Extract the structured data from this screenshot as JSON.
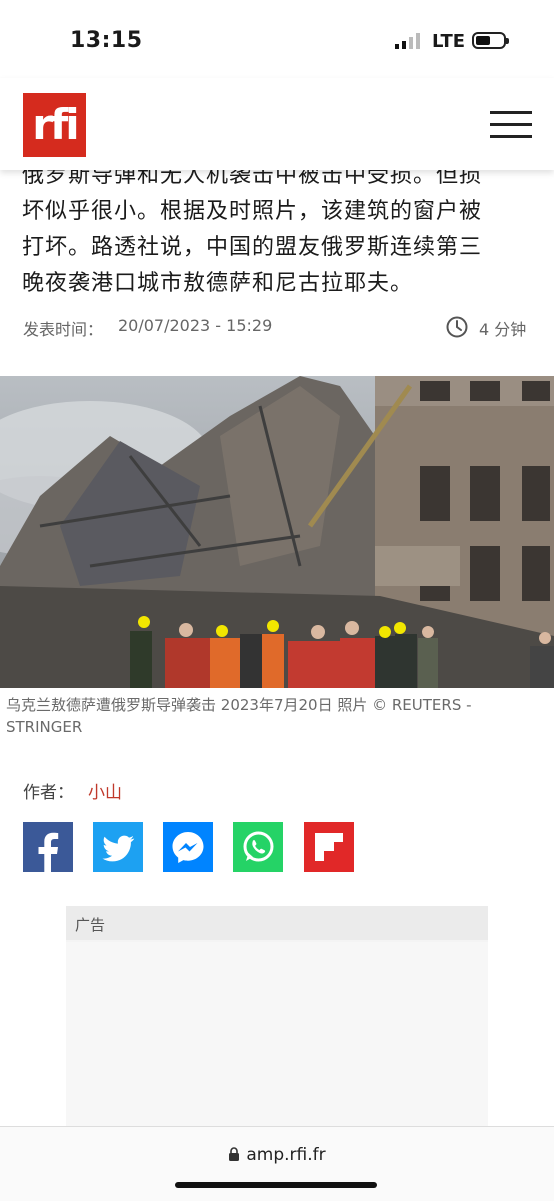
{
  "status": {
    "time": "13:15",
    "network": "LTE"
  },
  "header": {
    "logo_text": "rfi",
    "menu_icon": "hamburger-menu-icon"
  },
  "article": {
    "lines": [
      "俄罗斯导弹和无人机袭击中被击中受损。但损",
      "坏似乎很小。根据及时照片，该建筑的窗户被",
      "打坏。路透社说，中国的盟友俄罗斯连续第三",
      "晚夜袭港口城市敖德萨和尼古拉耶夫。"
    ],
    "date_label": "发表时间：",
    "date": "20/07/2023 - 15:29",
    "read_time": "4 分钟"
  },
  "photo": {
    "caption": "乌克兰敖德萨遭俄罗斯导弹袭击 2023年7月20日 照片  © REUTERS - STRINGER"
  },
  "author": {
    "label": "作者：",
    "name": "小山"
  },
  "share": [
    {
      "name": "facebook-icon",
      "color": "#3b5998"
    },
    {
      "name": "twitter-icon",
      "color": "#1da1f2"
    },
    {
      "name": "messenger-icon",
      "color": "#0084ff"
    },
    {
      "name": "whatsapp-icon",
      "color": "#25d366"
    },
    {
      "name": "flipboard-icon",
      "color": "#e12828"
    }
  ],
  "ad": {
    "label": "广告"
  },
  "browser": {
    "url": "amp.rfi.fr"
  },
  "colors": {
    "brand": "#d52b1e",
    "author": "#c0392b"
  }
}
